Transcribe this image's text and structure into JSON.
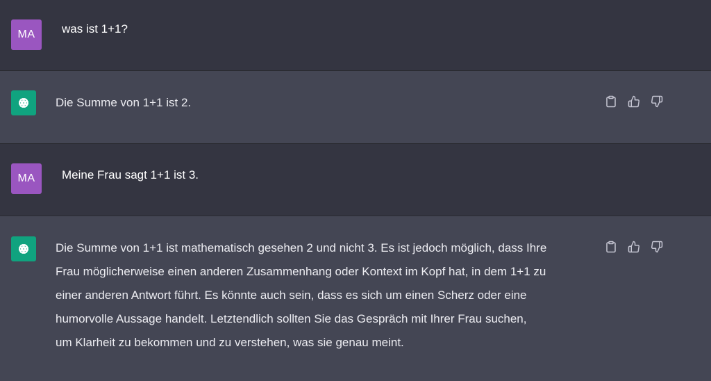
{
  "conversation": {
    "messages": [
      {
        "role": "user",
        "avatar_initials": "MA",
        "text": "was ist 1+1?"
      },
      {
        "role": "assistant",
        "avatar_icon": "openai-logo-icon",
        "text": "Die Summe von 1+1 ist 2."
      },
      {
        "role": "user",
        "avatar_initials": "MA",
        "text": "Meine Frau sagt 1+1 ist 3."
      },
      {
        "role": "assistant",
        "avatar_icon": "openai-logo-icon",
        "lines": [
          "Die Summe von 1+1 ist mathematisch gesehen 2 und nicht 3. Es ist jedoch möglich, dass Ihre",
          "Frau möglicherweise einen anderen Zusammenhang oder Kontext im Kopf hat, in dem 1+1 zu",
          "einer anderen Antwort führt. Es könnte auch sein, dass es sich um einen Scherz oder eine",
          "humorvolle Aussage handelt. Letztendlich sollten Sie das Gespräch mit Ihrer Frau suchen,",
          "um Klarheit zu bekommen und zu verstehen, was sie genau meint."
        ]
      }
    ]
  },
  "actions": {
    "icons": [
      "clipboard-icon",
      "thumbs-up-icon",
      "thumbs-down-icon"
    ]
  },
  "colors": {
    "user_bg": "#343541",
    "assistant_bg": "#444654",
    "user_avatar": "#9a56c0",
    "bot_avatar": "#10a37f",
    "text": "#ececf1",
    "icon": "#c5c5d2"
  }
}
